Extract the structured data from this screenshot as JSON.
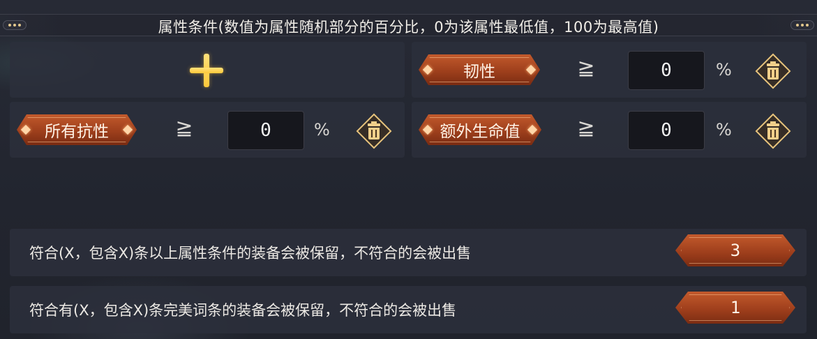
{
  "header": {
    "title": "属性条件(数值为属性随机部分的百分比，0为该属性最低值，100为最高值)"
  },
  "conditions": [
    {
      "attribute": "韧性",
      "operator": "≧",
      "value": "0",
      "unit": "%"
    },
    {
      "attribute": "所有抗性",
      "operator": "≧",
      "value": "0",
      "unit": "%"
    },
    {
      "attribute": "额外生命值",
      "operator": "≧",
      "value": "0",
      "unit": "%"
    }
  ],
  "rules": [
    {
      "text": "符合(X，包含X)条以上属性条件的装备会被保留，不符合的会被出售",
      "count": "3"
    },
    {
      "text": "符合有(X，包含X)条完美词条的装备会被保留，不符合的会被出售",
      "count": "1"
    }
  ],
  "icons": {
    "add": "plus-icon",
    "delete": "trash-icon",
    "header_ornament": "dots-icon"
  },
  "colors": {
    "accent_orange": "#b04a22",
    "gold": "#ffcf40",
    "background": "#232631"
  }
}
